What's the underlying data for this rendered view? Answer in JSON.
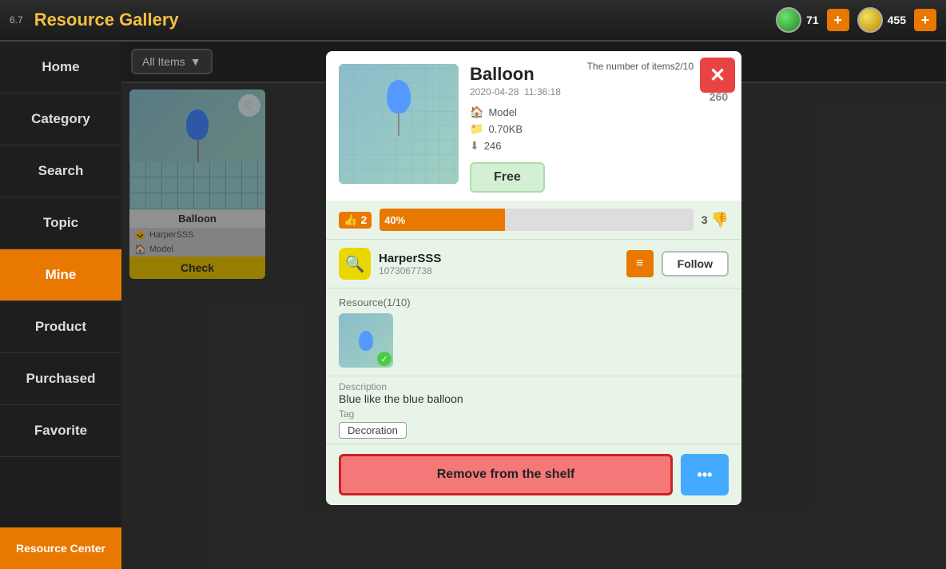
{
  "app": {
    "version": "6.7",
    "title": "Resource Gallery"
  },
  "topbar": {
    "title": "Resource Gallery",
    "currency1_count": "71",
    "currency2_count": "455",
    "add_label": "+",
    "item_count_label": "The number of items2/10"
  },
  "sidebar": {
    "items": [
      {
        "id": "home",
        "label": "Home"
      },
      {
        "id": "category",
        "label": "Category"
      },
      {
        "id": "search",
        "label": "Search"
      },
      {
        "id": "topic",
        "label": "Topic"
      },
      {
        "id": "mine",
        "label": "Mine",
        "active": true
      },
      {
        "id": "product",
        "label": "Product"
      },
      {
        "id": "purchased",
        "label": "Purchased"
      },
      {
        "id": "favorite",
        "label": "Favorite"
      }
    ],
    "resource_center_label": "Resource Center"
  },
  "filter": {
    "dropdown_label": "All Items",
    "dropdown_arrow": "▼"
  },
  "background_card": {
    "item_name": "Balloon",
    "creator_name": "HarperSSS",
    "creator_type": "Model",
    "check_label": "Check"
  },
  "modal": {
    "title": "Balloon",
    "date": "2020-04-28",
    "time": "11:36:18",
    "heart_count": "260",
    "type_label": "Model",
    "file_size": "0.70KB",
    "download_count": "246",
    "free_label": "Free",
    "close_icon": "✕",
    "item_count": "The number of items2/10",
    "rating": {
      "like_count": "2",
      "like_percent": "40%",
      "bar_percent": 40,
      "dislike_count": "3"
    },
    "author": {
      "name": "HarperSSS",
      "id": "1073067738",
      "follow_label": "Follow"
    },
    "resource": {
      "label": "Resource(1/10)"
    },
    "description": {
      "label": "Description",
      "text": "Blue like the blue balloon"
    },
    "tag": {
      "label": "Tag",
      "chip_label": "Decoration"
    },
    "actions": {
      "remove_label": "Remove from the shelf",
      "more_icon": "•••"
    }
  }
}
